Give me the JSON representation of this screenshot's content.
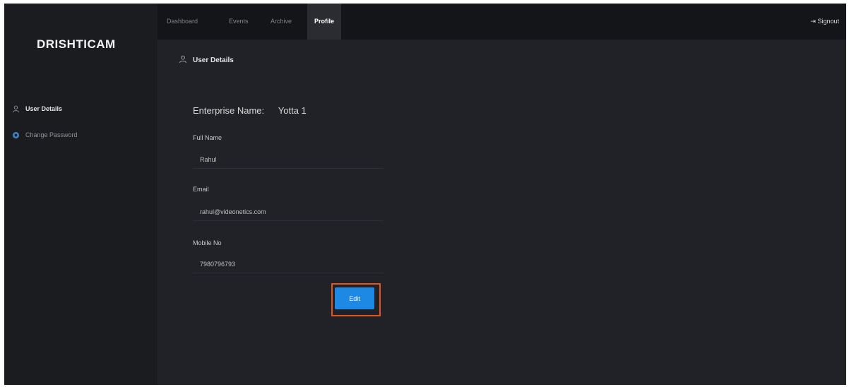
{
  "brand": {
    "logo_text": "DRISHTICAM"
  },
  "sidebar": {
    "items": [
      {
        "label": "User Details",
        "icon": "user-icon"
      },
      {
        "label": "Change Password",
        "icon": "gear-icon"
      }
    ]
  },
  "nav": {
    "tabs": [
      {
        "label": "Dashboard"
      },
      {
        "label": "Events"
      },
      {
        "label": "Archive"
      },
      {
        "label": "Profile"
      }
    ],
    "signout_label": "Signout"
  },
  "main": {
    "section_title": "User Details",
    "enterprise": {
      "label": "Enterprise Name:",
      "value": "Yotta 1"
    },
    "fields": [
      {
        "label": "Full Name",
        "value": "Rahul"
      },
      {
        "label": "Email",
        "value": "rahul@videonetics.com"
      },
      {
        "label": "Mobile No",
        "value": "7980796793"
      }
    ],
    "edit_label": "Edit"
  },
  "colors": {
    "accent": "#1e88e5",
    "highlight": "#e4541e",
    "background": "#202227",
    "topbar": "#141518"
  }
}
